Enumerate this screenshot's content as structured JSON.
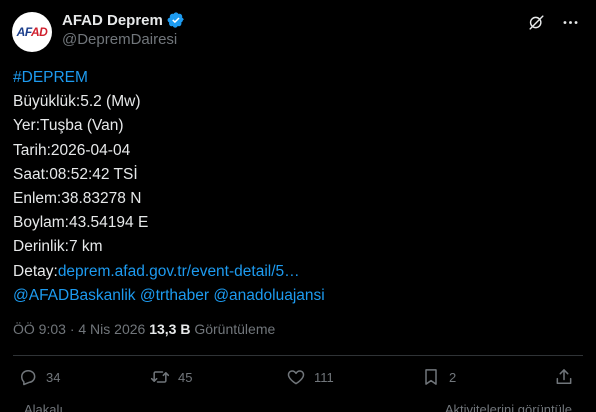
{
  "author": {
    "display_name": "AFAD Deprem",
    "handle": "@DepremDairesi",
    "avatar_text_blue": "AF",
    "avatar_text_red": "AD",
    "verified_icon": "verified-badge-icon"
  },
  "tweet": {
    "hashtag": "#DEPREM",
    "lines": [
      "Büyüklük:5.2 (Mw)",
      "Yer:Tuşba (Van)",
      "Tarih:2026-04-04",
      "Saat:08:52:42 TSİ",
      "Enlem:38.83278 N",
      "Boylam:43.54194 E",
      "Derinlik:7 km"
    ],
    "detail_label": "Detay:",
    "detail_link": "deprem.afad.gov.tr/event-detail/5…",
    "mentions": "@AFADBaskanlik @trthaber @anadoluajansi"
  },
  "meta": {
    "time": "ÖÖ 9:03",
    "separator": "·",
    "date": "4 Nis 2026",
    "views_count": "13,3 B",
    "views_label": "Görüntüleme"
  },
  "actions": {
    "replies": "34",
    "reposts": "45",
    "likes": "111",
    "bookmarks": "2"
  },
  "footer": {
    "left": "Alakalı",
    "right": "Aktivitelerini görüntüle"
  },
  "colors": {
    "background": "#000000",
    "text": "#e7e9ea",
    "muted": "#71767b",
    "link": "#1d9bf0",
    "divider": "#2f3336"
  }
}
